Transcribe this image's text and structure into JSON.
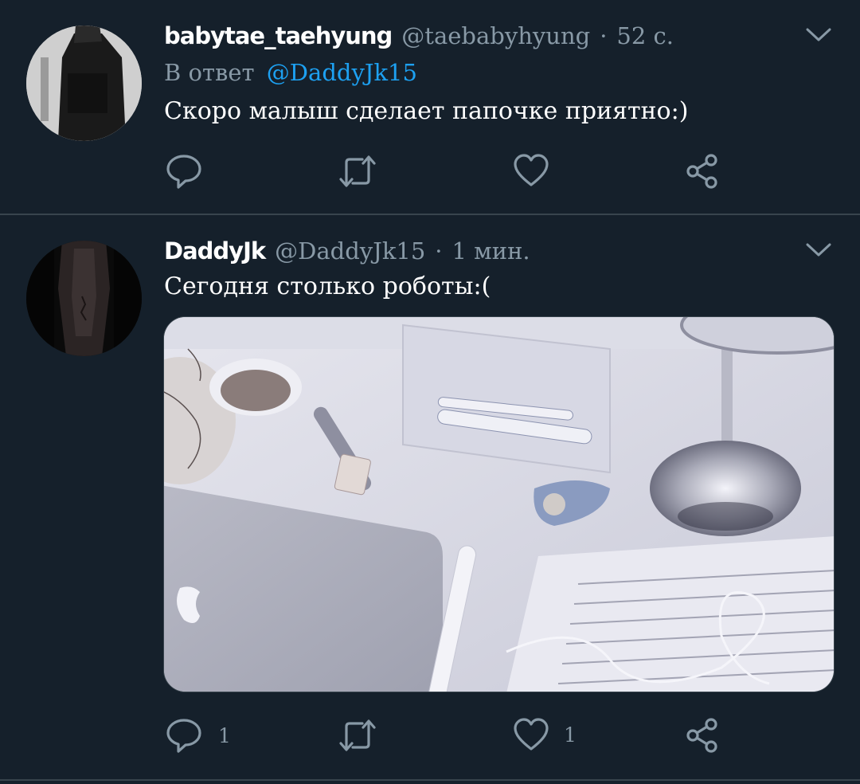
{
  "tweets": [
    {
      "name": "babytae_taehyung",
      "handle": "@taebabyhyung",
      "separator": "·",
      "time": "52 с.",
      "reply_prefix": "В ответ",
      "reply_to": "@DaddyJk15",
      "text": "Скоро малыш сделает папочке приятно:)",
      "reply_count": "",
      "like_count": ""
    },
    {
      "name": "DaddyJk",
      "handle": "@DaddyJk15",
      "separator": "·",
      "time": "1 мин.",
      "text": "Сегодня столько роботы:(",
      "reply_count": "1",
      "like_count": "1"
    }
  ],
  "icons": {
    "reply": "reply-icon",
    "retweet": "retweet-icon",
    "like": "heart-icon",
    "share": "share-icon",
    "menu": "chevron-down-icon"
  },
  "colors": {
    "background": "#15202b",
    "secondary_text": "#8899a6",
    "mention": "#1da1f2",
    "divider": "#38444d"
  }
}
